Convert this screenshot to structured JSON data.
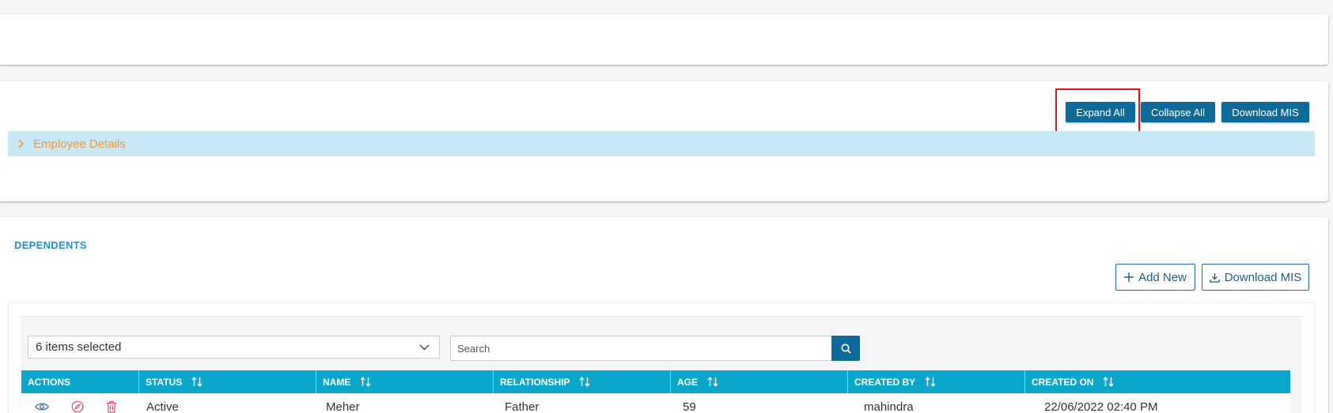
{
  "toolbar": {
    "expand_all": "Expand All",
    "collapse_all": "Collapse All",
    "download_mis": "Download MIS"
  },
  "accordion": {
    "label": "Employee Details"
  },
  "dependents": {
    "title": "DEPENDENTS",
    "add_new": "Add New",
    "download_mis": "Download MIS",
    "column_selector": "6 items selected",
    "search_placeholder": "Search",
    "columns": [
      "ACTIONS",
      "STATUS",
      "NAME",
      "RELATIONSHIP",
      "AGE",
      "CREATED BY",
      "CREATED ON"
    ],
    "rows": [
      {
        "status": "Active",
        "name": "Meher",
        "relationship": "Father",
        "age": "59",
        "created_by": "mahindra",
        "created_on": "22/06/2022 02:40 PM"
      }
    ]
  },
  "icons": {
    "view": "eye-icon",
    "edit": "compass-icon",
    "delete": "trash-icon",
    "search": "search-icon",
    "sort": "sort-icon",
    "add": "plus-icon",
    "download": "download-icon",
    "expand": "chevron-right-icon",
    "dropdown": "chevron-down-icon"
  },
  "colors": {
    "primary": "#0d6a99",
    "table_header": "#0aa7ca",
    "accordion_bg": "#c9e8f6",
    "accordion_text": "#f0993a",
    "section_title": "#2a8fc1",
    "highlight": "#e21414",
    "view_icon": "#3b6fb6",
    "action_icon": "#e0457b"
  }
}
